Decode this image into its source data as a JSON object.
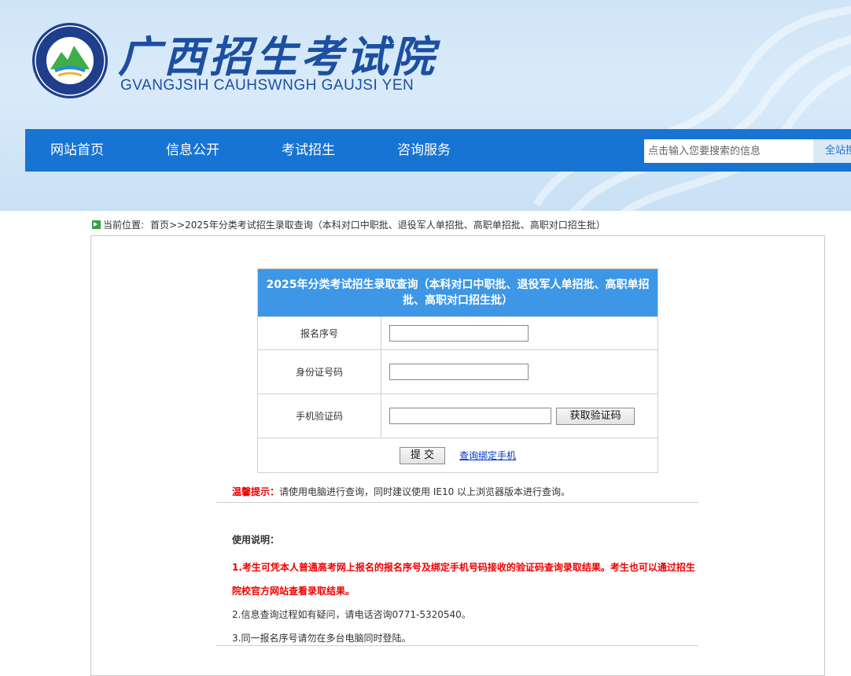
{
  "header": {
    "title": "广西招生考试院",
    "subtitle": "GVANGJSIH CAUHSWNGH GAUJSI YEN",
    "logo_ring_text": "GVANGJSIH CAUHSWNGH GAUJSI YEN",
    "logo_top_text": "广西招生考试院"
  },
  "nav": {
    "items": [
      "网站首页",
      "信息公开",
      "考试招生",
      "咨询服务"
    ],
    "search_placeholder": "点击输入您要搜索的信息",
    "search_button": "全站搜索"
  },
  "breadcrumb": {
    "prefix": "当前位置:",
    "path": "首页>>2025年分类考试招生录取查询（本科对口中职批、退役军人单招批、高职单招批、高职对口招生批）"
  },
  "form": {
    "title": "2025年分类考试招生录取查询（本科对口中职批、退役军人单招批、高职单招批、高职对口招生批）",
    "labels": {
      "registration_number": "报名序号",
      "id_number": "身份证号码",
      "sms_code": "手机验证码"
    },
    "get_code_button": "获取验证码",
    "submit_button": "提 交",
    "bind_phone_link": "查询绑定手机"
  },
  "tip": {
    "label": "温馨提示：",
    "text": "请使用电脑进行查询，同时建议使用 IE10 以上浏览器版本进行查询。"
  },
  "instructions": {
    "heading": "使用说明：",
    "items": [
      "1.考生可凭本人普通高考网上报名的报名序号及绑定手机号码接收的验证码查询录取结果。考生也可以通过招生院校官方网站查看录取结果。",
      "2.信息查询过程如有疑问，请电话咨询0771-5320540。",
      "3.同一报名序号请勿在多台电脑同时登陆。"
    ]
  },
  "colors": {
    "nav_bg": "#1774d3",
    "form_header_bg": "#3d97e6",
    "title_blue": "#1c4fa1",
    "warning_red": "#e00000"
  }
}
